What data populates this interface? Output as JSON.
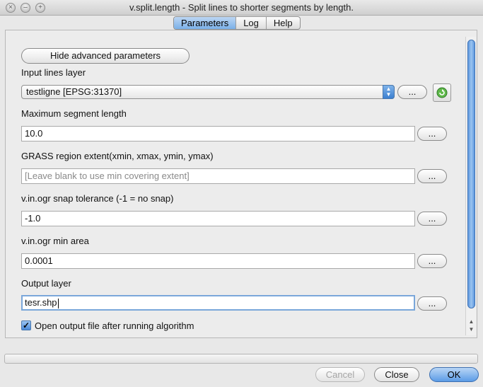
{
  "window": {
    "title": "v.split.length - Split lines to shorter segments by length."
  },
  "tabs": [
    {
      "label": "Parameters",
      "active": true
    },
    {
      "label": "Log",
      "active": false
    },
    {
      "label": "Help",
      "active": false
    }
  ],
  "form": {
    "advanced_button": "Hide advanced parameters",
    "input_layer": {
      "label": "Input lines layer",
      "value": "testligne [EPSG:31370]",
      "browse": "..."
    },
    "max_segment": {
      "label": "Maximum segment length",
      "value": "10.0",
      "browse": "..."
    },
    "region_extent": {
      "label": "GRASS region extent(xmin, xmax, ymin, ymax)",
      "placeholder": "[Leave blank to use min covering extent]",
      "browse": "..."
    },
    "snap_tolerance": {
      "label": "v.in.ogr snap tolerance (-1 = no snap)",
      "value": "-1.0",
      "browse": "..."
    },
    "min_area": {
      "label": "v.in.ogr min area",
      "value": "0.0001",
      "browse": "..."
    },
    "output_layer": {
      "label": "Output layer",
      "value": "tesr.shp",
      "browse": "..."
    },
    "open_output": {
      "label": "Open output file after running algorithm",
      "checked": true
    }
  },
  "footer": {
    "cancel": "Cancel",
    "close": "Close",
    "ok": "OK"
  },
  "colors": {
    "accent": "#5b9be6",
    "focus_ring": "#7aa7da"
  },
  "icons": {
    "refresh": "refresh-icon",
    "checkmark": "checkmark-icon"
  }
}
